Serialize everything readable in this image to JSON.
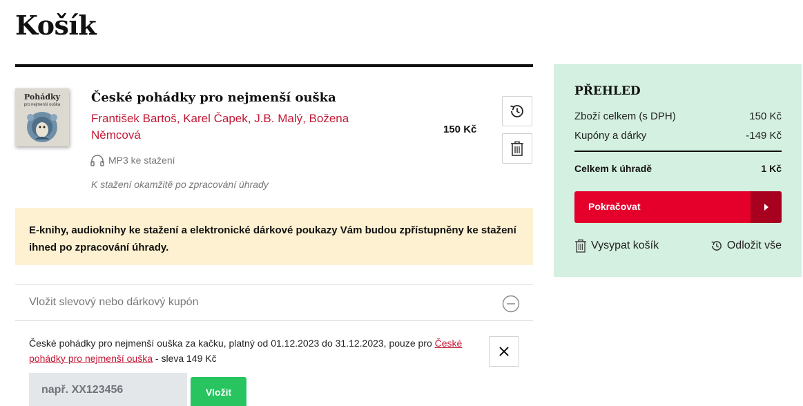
{
  "page": {
    "title": "Košík"
  },
  "cart": {
    "item": {
      "cover_title": "Pohádky",
      "cover_subtitle": "pro nejmenší ouška",
      "title": "České pohádky pro nejmenší ouška",
      "authors": "František Bartoš, Karel Čapek, J.B. Malý, Božena Němcová",
      "format": "MP3 ke stažení",
      "format_icon": "headphones-icon",
      "delivery_note": "K stažení okamžitě po zpracování úhrady",
      "price": "150 Kč",
      "actions": {
        "later_icon": "history-icon",
        "delete_icon": "trash-icon"
      }
    },
    "notice": "E-knihy, audioknihy ke stažení a elektronické dárkové poukazy Vám budou zpřístupněny ke stažení ihned po zpracování úhrady.",
    "coupon": {
      "header_label": "Vložit slevový nebo dárkový kupón",
      "toggle_icon": "minus-circle-icon",
      "offer_prefix": "České pohádky pro nejmenší ouška za kačku, platný od 01.12.2023 do 31.12.2023, pouze pro ",
      "offer_link": "České pohádky pro nejmenší ouška",
      "offer_suffix": " - sleva 149 Kč",
      "close_icon": "close-icon",
      "input_placeholder": "např. XX123456",
      "submit_label": "Vložit"
    }
  },
  "summary": {
    "title": "PŘEHLED",
    "goods_label": "Zboží celkem (s DPH)",
    "goods_value": "150 Kč",
    "coupons_label": "Kupóny a dárky",
    "coupons_value": "-149 Kč",
    "total_label": "Celkem k úhradě",
    "total_value": "1 Kč",
    "continue_label": "Pokračovat",
    "empty_label": "Vysypat košík",
    "postpone_label": "Odložit vše"
  },
  "colors": {
    "accent_red": "#e4002b",
    "author_red": "#c11a36",
    "summary_bg": "#d4f0e0",
    "notice_bg": "#fdf1d1",
    "submit_green": "#27c460"
  }
}
